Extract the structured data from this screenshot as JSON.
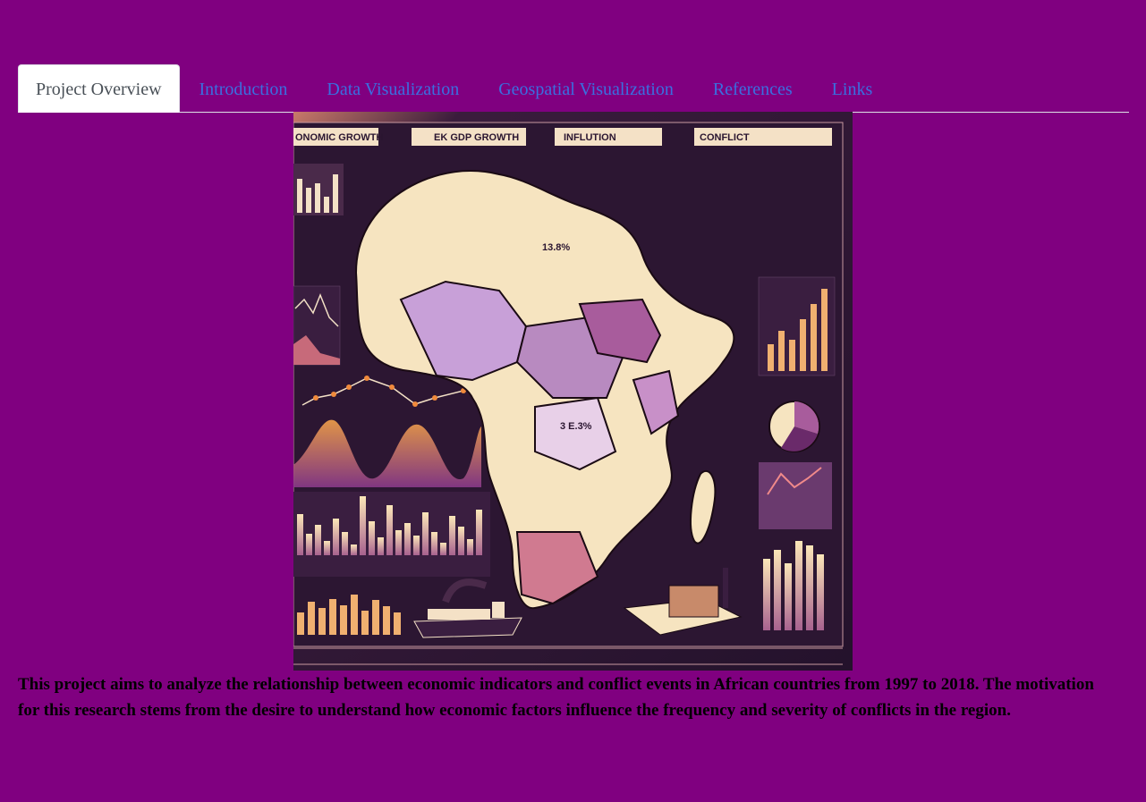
{
  "tabs": [
    {
      "label": "Project Overview",
      "active": true
    },
    {
      "label": "Introduction",
      "active": false
    },
    {
      "label": "Data Visualization",
      "active": false
    },
    {
      "label": "Geospatial Visualization",
      "active": false
    },
    {
      "label": "References",
      "active": false
    },
    {
      "label": "Links",
      "active": false
    }
  ],
  "hero": {
    "headers": [
      "ONOMIC GROWTH",
      "EK GDP GROWTH",
      "INFLUTION",
      "CONFLICT"
    ],
    "map_labels": [
      "13.8%",
      "3 E.3%"
    ]
  },
  "description": "This project aims to analyze the relationship between economic indicators and conflict events in African countries from 1997 to 2018. The motivation for this research stems from the desire to understand how economic factors influence the frequency and severity of conflicts in the region.",
  "colors": {
    "page_background": "#800080",
    "tab_link": "#3a6fe0",
    "tab_active_text": "#495057",
    "infographic_dark": "#2a1530",
    "infographic_cream": "#f6e4c0",
    "infographic_orange": "#f08a3c"
  }
}
